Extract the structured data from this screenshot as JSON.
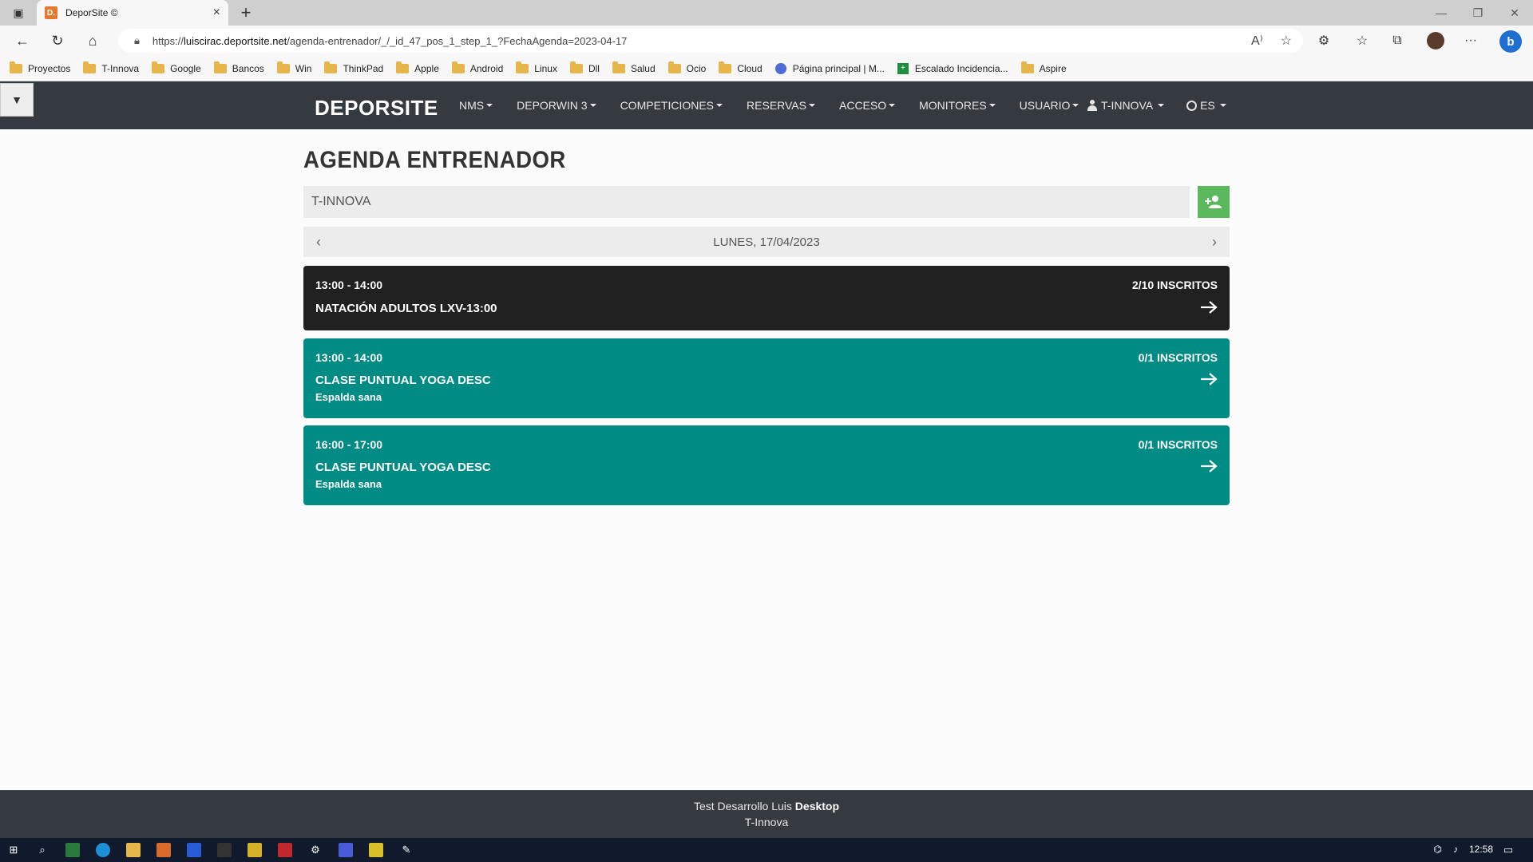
{
  "browser": {
    "tab_title": "DeporSite ©",
    "favicon_text": "D.",
    "url_prefix": "https://",
    "url_host": "luiscirac.deportsite.net",
    "url_path": "/agenda-entrenador/_/_id_47_pos_1_step_1_?FechaAgenda=2023-04-17",
    "bookmarks": [
      "Proyectos",
      "T-Innova",
      "Google",
      "Bancos",
      "Win",
      "ThinkPad",
      "Apple",
      "Android",
      "Linux",
      "Dll",
      "Salud",
      "Ocio",
      "Cloud",
      "Página principal | M...",
      "Escalado Incidencia...",
      "Aspire"
    ]
  },
  "navbar": {
    "brand": "DEPORSITE",
    "menu": [
      "NMS",
      "DEPORWIN 3",
      "COMPETICIONES",
      "RESERVAS",
      "ACCESO",
      "MONITORES",
      "USUARIO"
    ],
    "user": "T-INNOVA",
    "language": "ES"
  },
  "page": {
    "title": "AGENDA ENTRENADOR",
    "trainer_value": "T-INNOVA",
    "date_label": "LUNES, 17/04/2023"
  },
  "sessions": [
    {
      "time": "13:00 - 14:00",
      "name": "NATACIÓN ADULTOS LXV-13:00",
      "subtitle": "",
      "enrolled": "2/10 INSCRITOS"
    },
    {
      "time": "13:00 - 14:00",
      "name": "CLASE PUNTUAL YOGA DESC",
      "subtitle": "Espalda sana",
      "enrolled": "0/1 INSCRITOS"
    },
    {
      "time": "16:00 - 17:00",
      "name": "CLASE PUNTUAL YOGA DESC",
      "subtitle": "Espalda sana",
      "enrolled": "0/1 INSCRITOS"
    }
  ],
  "footer": {
    "line1_prefix": "Test Desarrollo Luis ",
    "line1_bold": "Desktop",
    "line2": "T-Innova"
  },
  "taskbar": {
    "clock": "12:58"
  },
  "colors": {
    "navbar": "#343a40",
    "session_dark": "#212121",
    "session_teal": "#008b84",
    "add_button": "#5cb85c"
  }
}
